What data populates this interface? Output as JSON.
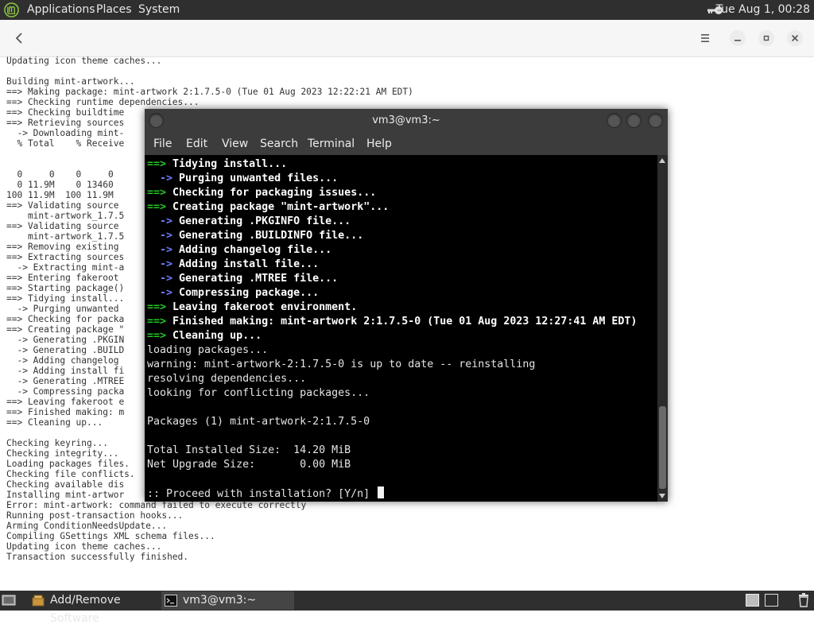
{
  "top_panel": {
    "menus": [
      "Applications",
      "Places",
      "System"
    ],
    "clock": "Tue Aug 1, 00:28",
    "icons": [
      "mint-logo-icon",
      "key-icon"
    ]
  },
  "background_app": {
    "icons": [
      "back-arrow-icon",
      "hamburger-menu-icon",
      "minimize-icon",
      "maximize-icon",
      "close-icon"
    ],
    "log_lines": [
      "Updating icon theme caches...",
      "",
      "Building mint-artwork...",
      "==> Making package: mint-artwork 2:1.7.5-0 (Tue 01 Aug 2023 12:22:21 AM EDT)",
      "==> Checking runtime dependencies...",
      "==> Checking buildtime",
      "==> Retrieving sources",
      "  -> Downloading mint-",
      "  % Total    % Receive",
      "",
      "",
      "  0     0    0     0",
      "  0 11.9M    0 13460",
      "100 11.9M  100 11.9M",
      "==> Validating source",
      "    mint-artwork_1.7.5",
      "==> Validating source",
      "    mint-artwork_1.7.5",
      "==> Removing existing",
      "==> Extracting sources",
      "  -> Extracting mint-a",
      "==> Entering fakeroot",
      "==> Starting package()",
      "==> Tidying install...",
      "  -> Purging unwanted",
      "==> Checking for packa",
      "==> Creating package \"",
      "  -> Generating .PKGIN",
      "  -> Generating .BUILD",
      "  -> Adding changelog",
      "  -> Adding install fi",
      "  -> Generating .MTREE",
      "  -> Compressing packa",
      "==> Leaving fakeroot e",
      "==> Finished making: m",
      "==> Cleaning up...",
      "",
      "Checking keyring...",
      "Checking integrity...",
      "Loading packages files.",
      "Checking file conflicts.",
      "Checking available dis",
      "Installing mint-artwor",
      "Error: mint-artwork: command failed to execute correctly",
      "Running post-transaction hooks...",
      "Arming ConditionNeedsUpdate...",
      "Compiling GSettings XML schema files...",
      "Updating icon theme caches...",
      "Transaction successfully finished."
    ]
  },
  "terminal": {
    "title": "vm3@vm3:~",
    "menu": [
      "File",
      "Edit",
      "View",
      "Search",
      "Terminal",
      "Help"
    ],
    "lines": [
      {
        "prefix": "==>",
        "prefix_color": "green",
        "text": " Tidying install...",
        "bold": true
      },
      {
        "prefix": "  ->",
        "prefix_color": "blue",
        "text": " Purging unwanted files...",
        "bold": true
      },
      {
        "prefix": "==>",
        "prefix_color": "green",
        "text": " Checking for packaging issues...",
        "bold": true
      },
      {
        "prefix": "==>",
        "prefix_color": "green",
        "text": " Creating package \"mint-artwork\"...",
        "bold": true
      },
      {
        "prefix": "  ->",
        "prefix_color": "blue",
        "text": " Generating .PKGINFO file...",
        "bold": true
      },
      {
        "prefix": "  ->",
        "prefix_color": "blue",
        "text": " Generating .BUILDINFO file...",
        "bold": true
      },
      {
        "prefix": "  ->",
        "prefix_color": "blue",
        "text": " Adding changelog file...",
        "bold": true
      },
      {
        "prefix": "  ->",
        "prefix_color": "blue",
        "text": " Adding install file...",
        "bold": true
      },
      {
        "prefix": "  ->",
        "prefix_color": "blue",
        "text": " Generating .MTREE file...",
        "bold": true
      },
      {
        "prefix": "  ->",
        "prefix_color": "blue",
        "text": " Compressing package...",
        "bold": true
      },
      {
        "prefix": "==>",
        "prefix_color": "green",
        "text": " Leaving fakeroot environment.",
        "bold": true
      },
      {
        "prefix": "==>",
        "prefix_color": "green",
        "text": " Finished making: mint-artwork 2:1.7.5-0 (Tue 01 Aug 2023 12:27:41 AM EDT)",
        "bold": true
      },
      {
        "prefix": "==>",
        "prefix_color": "green",
        "text": " Cleaning up...",
        "bold": true
      },
      {
        "prefix": "",
        "text": "loading packages...",
        "bold": false
      },
      {
        "prefix": "",
        "text": "warning: mint-artwork-2:1.7.5-0 is up to date -- reinstalling",
        "bold": false
      },
      {
        "prefix": "",
        "text": "resolving dependencies...",
        "bold": false
      },
      {
        "prefix": "",
        "text": "looking for conflicting packages...",
        "bold": false
      },
      {
        "prefix": "",
        "text": "",
        "bold": false
      },
      {
        "prefix": "",
        "text": "Packages (1) mint-artwork-2:1.7.5-0",
        "bold": false
      },
      {
        "prefix": "",
        "text": "",
        "bold": false
      },
      {
        "prefix": "",
        "text": "Total Installed Size:  14.20 MiB",
        "bold": false
      },
      {
        "prefix": "",
        "text": "Net Upgrade Size:       0.00 MiB",
        "bold": false
      },
      {
        "prefix": "",
        "text": "",
        "bold": false
      },
      {
        "prefix": "",
        "text": ":: Proceed with installation? [Y/n] ",
        "bold": false,
        "cursor": true
      }
    ],
    "scroll_position": 0.85
  },
  "bottom_panel": {
    "tasks": [
      {
        "label": "Add/Remove Software",
        "icon": "package-icon",
        "active": false
      },
      {
        "label": "vm3@vm3:~",
        "icon": "terminal-icon",
        "active": true
      }
    ],
    "workspaces": 2,
    "active_workspace": 1,
    "icons": [
      "show-desktop-icon",
      "trash-icon"
    ]
  },
  "colors": {
    "panel": "#2f2f2f",
    "terminal_bg": "#000000",
    "prompt_green": "#25c825",
    "arrow_blue": "#6f7dff"
  }
}
